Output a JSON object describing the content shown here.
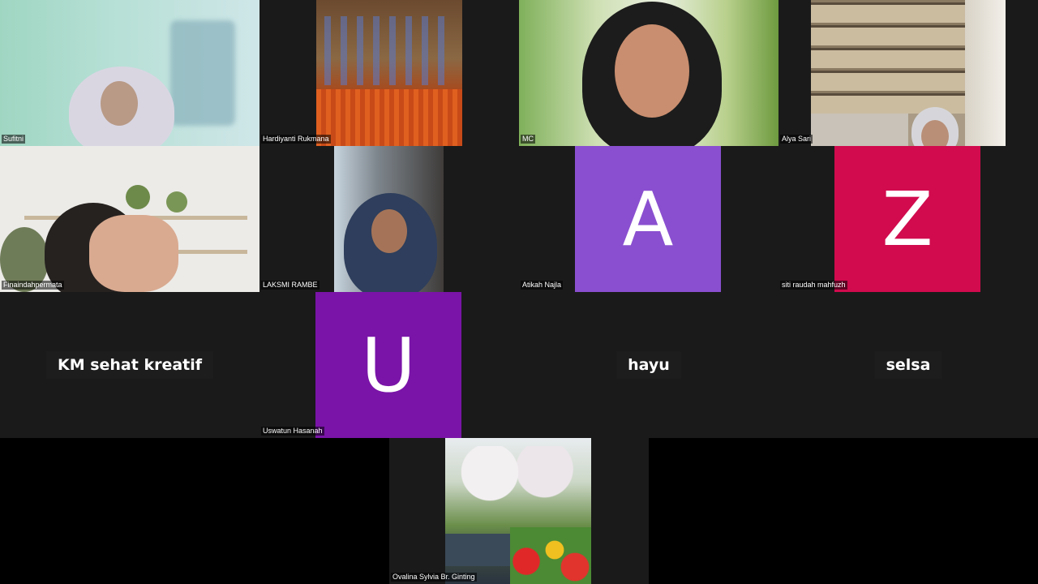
{
  "participants": [
    {
      "name": "Sufitni",
      "kind": "video"
    },
    {
      "name": "Hardiyanti Rukmana",
      "kind": "video"
    },
    {
      "name": "MC",
      "kind": "video"
    },
    {
      "name": "Alya Sari",
      "kind": "video"
    },
    {
      "name": "Finaindahpermata",
      "kind": "video"
    },
    {
      "name": "LAKSMI RAMBE",
      "kind": "video"
    },
    {
      "name": "Atikah Najla",
      "kind": "avatar",
      "initial": "A",
      "color": "#8a4fd0"
    },
    {
      "name": "siti raudah mahfuzh",
      "kind": "avatar",
      "initial": "Z",
      "color": "#d10b4e"
    },
    {
      "name": "KM sehat kreatif",
      "kind": "name-only"
    },
    {
      "name": "Uswatun Hasanah",
      "kind": "avatar",
      "initial": "U",
      "color": "#7a14a8"
    },
    {
      "name": "hayu",
      "kind": "name-only"
    },
    {
      "name": "selsa",
      "kind": "name-only"
    },
    {
      "name": "Ovalina Sylvia Br. Ginting",
      "kind": "video"
    }
  ]
}
